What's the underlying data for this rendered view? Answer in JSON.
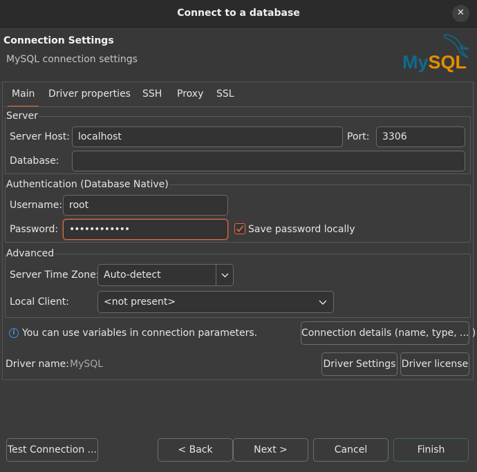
{
  "window": {
    "title": "Connect to a database",
    "close_glyph": "✕"
  },
  "header": {
    "title": "Connection Settings",
    "subtitle": "MySQL connection settings",
    "logo_text": "MySQL"
  },
  "tabs": [
    {
      "label": "Main",
      "active": true
    },
    {
      "label": "Driver properties"
    },
    {
      "label": "SSH"
    },
    {
      "label": "Proxy"
    },
    {
      "label": "SSL"
    }
  ],
  "server": {
    "legend": "Server",
    "host_label": "Server Host:",
    "host_value": "localhost",
    "port_label": "Port:",
    "port_value": "3306",
    "database_label": "Database:",
    "database_value": ""
  },
  "auth": {
    "legend": "Authentication (Database Native)",
    "username_label": "Username:",
    "username_value": "root",
    "password_label": "Password:",
    "password_value": "••••••••••••",
    "save_password_label": "Save password locally",
    "save_password_checked": true
  },
  "advanced": {
    "legend": "Advanced",
    "timezone_label": "Server Time Zone:",
    "timezone_value": "Auto-detect",
    "local_client_label": "Local Client:",
    "local_client_value": "<not present>"
  },
  "info": {
    "variables_text": "You can use variables in connection parameters.",
    "connection_details_button": "Connection details (name, type, ... )"
  },
  "driver": {
    "name_label": "Driver name:",
    "name_value": "MySQL",
    "settings_button": "Driver Settings",
    "license_button": "Driver license"
  },
  "footer": {
    "test_button": "Test Connection ...",
    "back_button": "< Back",
    "next_button": "Next >",
    "cancel_button": "Cancel",
    "finish_button": "Finish"
  },
  "colors": {
    "accent": "#e06b45",
    "info": "#4a90d9",
    "mysql_blue": "#0f6b8f",
    "mysql_orange": "#e48e00"
  }
}
